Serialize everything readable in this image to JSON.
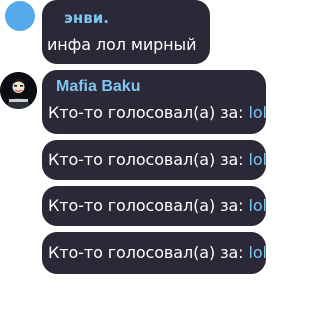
{
  "messages": [
    {
      "sender": "энви.",
      "text": "инфа лол мирный"
    },
    {
      "sender": "Mafia Baku",
      "text_prefix": "Кто-то голосовал(а) за: ",
      "vote": "lol"
    },
    {
      "text_prefix": "Кто-то голосовал(а) за: ",
      "vote": "lol"
    },
    {
      "text_prefix": "Кто-то голосовал(а) за: ",
      "vote": "lol"
    },
    {
      "text_prefix": "Кто-то голосовал(а) за: ",
      "vote": "lol"
    }
  ],
  "colors": {
    "bubble": "#2b2838",
    "sender_name": "#7fc6ef",
    "vote_link": "#7fc6ef",
    "avatar_envy": "#54a9ea",
    "avatar_mafia": "#0b0d12"
  },
  "icons": {
    "envy_avatar": "blue-circle-avatar",
    "mafia_avatar": "masked-figure-avatar"
  }
}
